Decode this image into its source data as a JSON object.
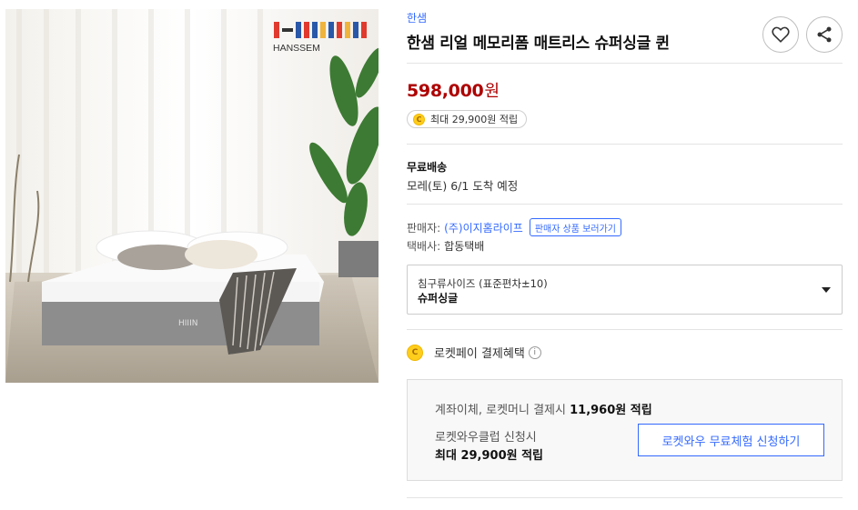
{
  "product": {
    "brand": "한샘",
    "title": "한샘 리얼 메모리폼 매트리스 슈퍼싱글 퀸",
    "image_logo_text": "HANSSEM",
    "image_mattress_label": "HIIIN"
  },
  "actions": {
    "wishlist_icon": "heart-icon",
    "share_icon": "share-icon"
  },
  "price": {
    "amount": "598,000",
    "currency": "원",
    "color": "#ae0000"
  },
  "cash": {
    "coin_symbol": "C",
    "text": "최대 29,900원 적립"
  },
  "shipping": {
    "title": "무료배송",
    "arrival": "모레(토) 6/1 도착 예정"
  },
  "seller": {
    "label": "판매자:",
    "name": "(주)이지홈라이프",
    "link_label": "판매자 상품 보러가기",
    "courier_label": "택배사:",
    "courier_name": "합동택배"
  },
  "option": {
    "label": "침구류사이즈 (표준편차±10)",
    "selected": "슈퍼싱글"
  },
  "rocketpay": {
    "coin_symbol": "C",
    "label": "로켓페이 결제혜택",
    "info_symbol": "i"
  },
  "benefits": {
    "line1_prefix": "계좌이체, 로켓머니 결제시",
    "line1_amount": "11,960원 적립",
    "line2": "로켓와우클럽 신청시",
    "line3": "최대 29,900원 적립",
    "button_label": "로켓와우 무료체험 신청하기"
  },
  "colors": {
    "accent_blue": "#346aff",
    "price_red": "#ae0000",
    "coin_yellow": "#ffcd1c"
  }
}
